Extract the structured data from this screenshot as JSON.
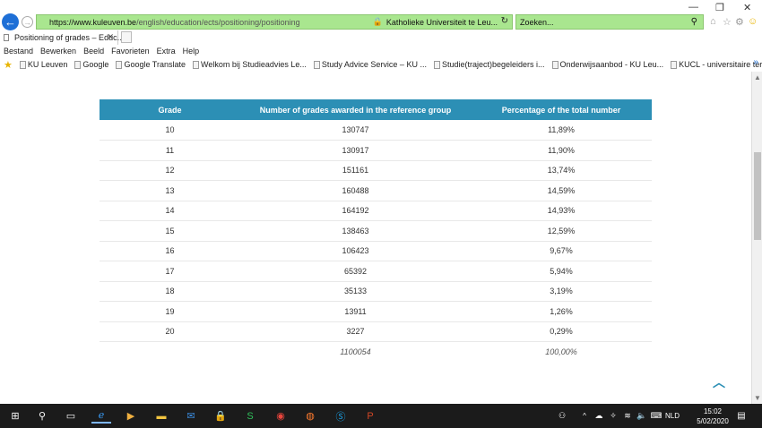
{
  "browser": {
    "url_prefix": "https://www.",
    "url_domain": "kuleuven.be",
    "url_path": "/english/education/ects/positioning/positioning",
    "site_name": "Katholieke Universiteit te Leu...",
    "search_placeholder": "Zoeken...",
    "tab_title": "Positioning of grades – Educ...",
    "menu": [
      "Bestand",
      "Bewerken",
      "Beeld",
      "Favorieten",
      "Extra",
      "Help"
    ],
    "favorites": [
      "KU Leuven",
      "Google",
      "Google Translate",
      "Welkom bij Studieadvies Le...",
      "Study Advice Service – KU ...",
      "Studie(traject)begeleiders i...",
      "Onderwijsaanbod - KU Leu...",
      "KUCL - universitaire termin..."
    ],
    "accent": "#1e6fd6",
    "address_bg": "#a9e68f"
  },
  "table": {
    "headers": [
      "Grade",
      "Number of grades awarded in the reference group",
      "Percentage of the total number"
    ],
    "rows": [
      [
        "10",
        "130747",
        "11,89%"
      ],
      [
        "11",
        "130917",
        "11,90%"
      ],
      [
        "12",
        "151161",
        "13,74%"
      ],
      [
        "13",
        "160488",
        "14,59%"
      ],
      [
        "14",
        "164192",
        "14,93%"
      ],
      [
        "15",
        "138463",
        "12,59%"
      ],
      [
        "16",
        "106423",
        "9,67%"
      ],
      [
        "17",
        "65392",
        "5,94%"
      ],
      [
        "18",
        "35133",
        "3,19%"
      ],
      [
        "19",
        "13911",
        "1,26%"
      ],
      [
        "20",
        "3227",
        "0,29%"
      ]
    ],
    "total": [
      "",
      "1100054",
      "100,00%"
    ],
    "header_color": "#2c8fb5"
  },
  "taskbar": {
    "language": "NLD",
    "time": "15:02",
    "date": "5/02/2020"
  }
}
